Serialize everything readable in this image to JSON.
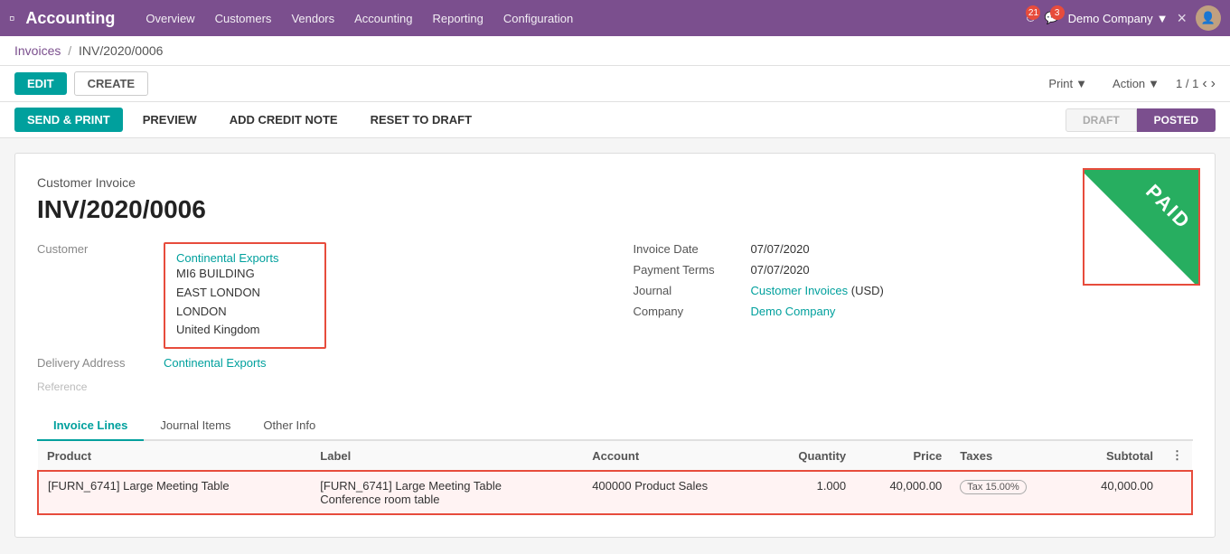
{
  "topnav": {
    "app_name": "Accounting",
    "nav_links": [
      "Overview",
      "Customers",
      "Vendors",
      "Accounting",
      "Reporting",
      "Configuration"
    ],
    "clock_badge": "21",
    "chat_badge": "3",
    "company": "Demo Company",
    "close_label": "×"
  },
  "breadcrumb": {
    "parent": "Invoices",
    "separator": "/",
    "current": "INV/2020/0006"
  },
  "action_bar": {
    "edit_label": "EDIT",
    "create_label": "CREATE",
    "print_label": "Print",
    "action_label": "Action",
    "pagination": "1 / 1"
  },
  "secondary_bar": {
    "send_print_label": "SEND & PRINT",
    "preview_label": "PREVIEW",
    "add_credit_note_label": "ADD CREDIT NOTE",
    "reset_to_draft_label": "RESET TO DRAFT",
    "status_draft": "DRAFT",
    "status_posted": "POSTED"
  },
  "invoice": {
    "type": "Customer Invoice",
    "number": "INV/2020/0006",
    "paid_stamp": "PAID",
    "customer_label": "Customer",
    "customer_name": "Continental Exports",
    "customer_address_line1": "MI6 BUILDING",
    "customer_address_line2": "EAST LONDON",
    "customer_address_line3": "LONDON",
    "customer_address_line4": "United Kingdom",
    "delivery_address_label": "Delivery Address",
    "delivery_address_value": "Continental Exports",
    "reference_label": "Reference",
    "invoice_date_label": "Invoice Date",
    "invoice_date_value": "07/07/2020",
    "payment_terms_label": "Payment Terms",
    "payment_terms_value": "07/07/2020",
    "journal_label": "Journal",
    "journal_value": "Customer Invoices",
    "journal_currency": "(USD)",
    "company_label": "Company",
    "company_value": "Demo Company"
  },
  "tabs": [
    {
      "label": "Invoice Lines",
      "active": true
    },
    {
      "label": "Journal Items",
      "active": false
    },
    {
      "label": "Other Info",
      "active": false
    }
  ],
  "table": {
    "headers": [
      "Product",
      "Label",
      "Account",
      "Quantity",
      "Price",
      "Taxes",
      "Subtotal"
    ],
    "rows": [
      {
        "product": "[FURN_6741] Large Meeting Table",
        "label_line1": "[FURN_6741] Large Meeting Table",
        "label_line2": "Conference room table",
        "account": "400000 Product Sales",
        "quantity": "1.000",
        "price": "40,000.00",
        "taxes": "Tax 15.00%",
        "subtotal": "40,000.00",
        "highlighted": true
      }
    ]
  }
}
